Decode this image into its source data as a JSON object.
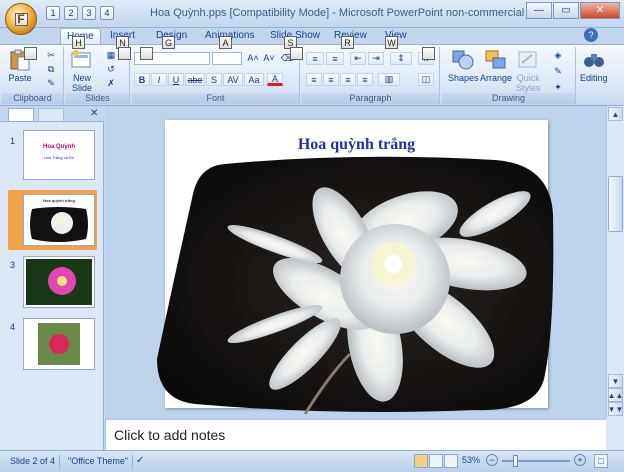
{
  "app": {
    "title": "Hoa Quỳnh.pps [Compatibility Mode] - Microsoft PowerPoint non-commercial use",
    "office_button_keytip": "F",
    "qat_keytips": [
      "1",
      "2",
      "3",
      "4"
    ]
  },
  "tabs": [
    {
      "label": "Home",
      "keytip": "H"
    },
    {
      "label": "Insert",
      "keytip": "N"
    },
    {
      "label": "Design",
      "keytip": "G"
    },
    {
      "label": "Animations",
      "keytip": "A"
    },
    {
      "label": "Slide Show",
      "keytip": "S"
    },
    {
      "label": "Review",
      "keytip": "R"
    },
    {
      "label": "View",
      "keytip": "W"
    }
  ],
  "ribbon": {
    "clipboard": {
      "label": "Clipboard",
      "paste": "Paste"
    },
    "slides": {
      "label": "Slides",
      "new_slide_line1": "New",
      "new_slide_line2": "Slide"
    },
    "font": {
      "label": "Font",
      "bold": "B",
      "italic": "I",
      "underline": "U",
      "strike": "abe",
      "shadow": "S",
      "spacing": "AV",
      "case": "Aa",
      "color": "A"
    },
    "paragraph": {
      "label": "Paragraph"
    },
    "drawing": {
      "label": "Drawing",
      "shapes": "Shapes",
      "arrange": "Arrange",
      "quick_styles_line1": "Quick",
      "quick_styles_line2": "Styles"
    },
    "editing": {
      "label": "Editing"
    }
  },
  "thumbnails": [
    {
      "num": "1",
      "title": "Hoa Quỳnh",
      "subtitle": "Hoa Trắng và Đỏ"
    },
    {
      "num": "2",
      "title": "Hoa quỳnh trắng"
    },
    {
      "num": "3"
    },
    {
      "num": "4"
    }
  ],
  "slide": {
    "title": "Hoa quỳnh trắng"
  },
  "notes": {
    "placeholder": "Click to add notes"
  },
  "status": {
    "slide_count": "Slide 2 of 4",
    "theme": "\"Office Theme\"",
    "zoom": "53%"
  },
  "colors": {
    "accent": "#15428b",
    "slide_title": "#2030a8",
    "selected_thumb": "#f2a34a"
  }
}
